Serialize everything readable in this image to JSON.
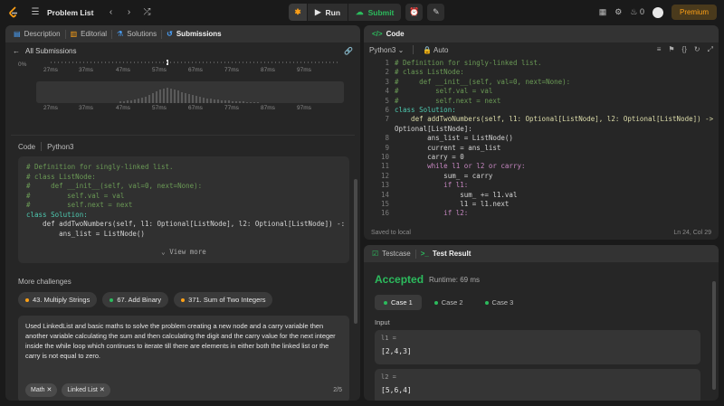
{
  "nav": {
    "title": "Problem List",
    "run": "Run",
    "submit": "Submit",
    "coins": "0",
    "premium": "Premium"
  },
  "left": {
    "tabs": [
      "Description",
      "Editorial",
      "Solutions",
      "Submissions"
    ],
    "back": "All Submissions",
    "chart": {
      "ytick": "0%",
      "xticks_top": [
        "27ms",
        "37ms",
        "47ms",
        "57ms",
        "67ms",
        "77ms",
        "87ms",
        "97ms"
      ],
      "xticks_bottom": [
        "27ms",
        "37ms",
        "47ms",
        "57ms",
        "67ms",
        "77ms",
        "87ms",
        "97ms"
      ]
    },
    "code_label": "Code",
    "code_lang": "Python3",
    "code_lines": [
      "# Definition for singly-linked list.",
      "# class ListNode:",
      "#     def __init__(self, val=0, next=None):",
      "#         self.val = val",
      "#         self.next = next",
      "class Solution:",
      "    def addTwoNumbers(self, l1: Optional[ListNode], l2: Optional[ListNode]) -:",
      "        ans_list = ListNode()"
    ],
    "view_more": "View more",
    "more_challenges": "More challenges",
    "challenges": [
      "43. Multiply Strings",
      "67. Add Binary",
      "371. Sum of Two Integers"
    ],
    "notes": "Used LinkedList and basic maths to solve the problem creating a new node and a carry variable then another variable calculating the sum and then calculating the digit and the carry value for the next integer inside the while loop which continues to iterate till there are elements in either both the linked list or the carry is not equal to zero.",
    "tags": [
      "Math",
      "Linked List"
    ],
    "pager": "2/5"
  },
  "code": {
    "title": "Code",
    "lang": "Python3",
    "mode": "Auto",
    "saved": "Saved to local",
    "cursor": "Ln 24, Col 29",
    "lines": [
      "# Definition for singly-linked list.",
      "# class ListNode:",
      "#     def __init__(self, val=0, next=None):",
      "#         self.val = val",
      "#         self.next = next",
      "class Solution:",
      "    def addTwoNumbers(self, l1: Optional[ListNode], l2: Optional[ListNode]) ->",
      "Optional[ListNode]:",
      "        ans_list = ListNode()",
      "        current = ans_list",
      "        carry = 0",
      "        while l1 or l2 or carry:",
      "            sum_ = carry",
      "            if l1:",
      "                sum_ += l1.val",
      "                l1 = l1.next",
      "            if l2:"
    ],
    "line_numbers": [
      "1",
      "2",
      "3",
      "4",
      "5",
      "6",
      "7",
      "",
      "8",
      "9",
      "10",
      "11",
      "12",
      "13",
      "14",
      "15",
      "16"
    ]
  },
  "test": {
    "tab_testcase": "Testcase",
    "tab_result": "Test Result",
    "status": "Accepted",
    "runtime": "Runtime: 69 ms",
    "cases": [
      "Case 1",
      "Case 2",
      "Case 3"
    ],
    "input_label": "Input",
    "l1_label": "l1 =",
    "l1_value": "[2,4,3]",
    "l2_label": "l2 =",
    "l2_value": "[5,6,4]"
  },
  "colors": {
    "accepted": "#2cbb5d",
    "accent": "#ffa116",
    "link": "#4aa3ff"
  }
}
